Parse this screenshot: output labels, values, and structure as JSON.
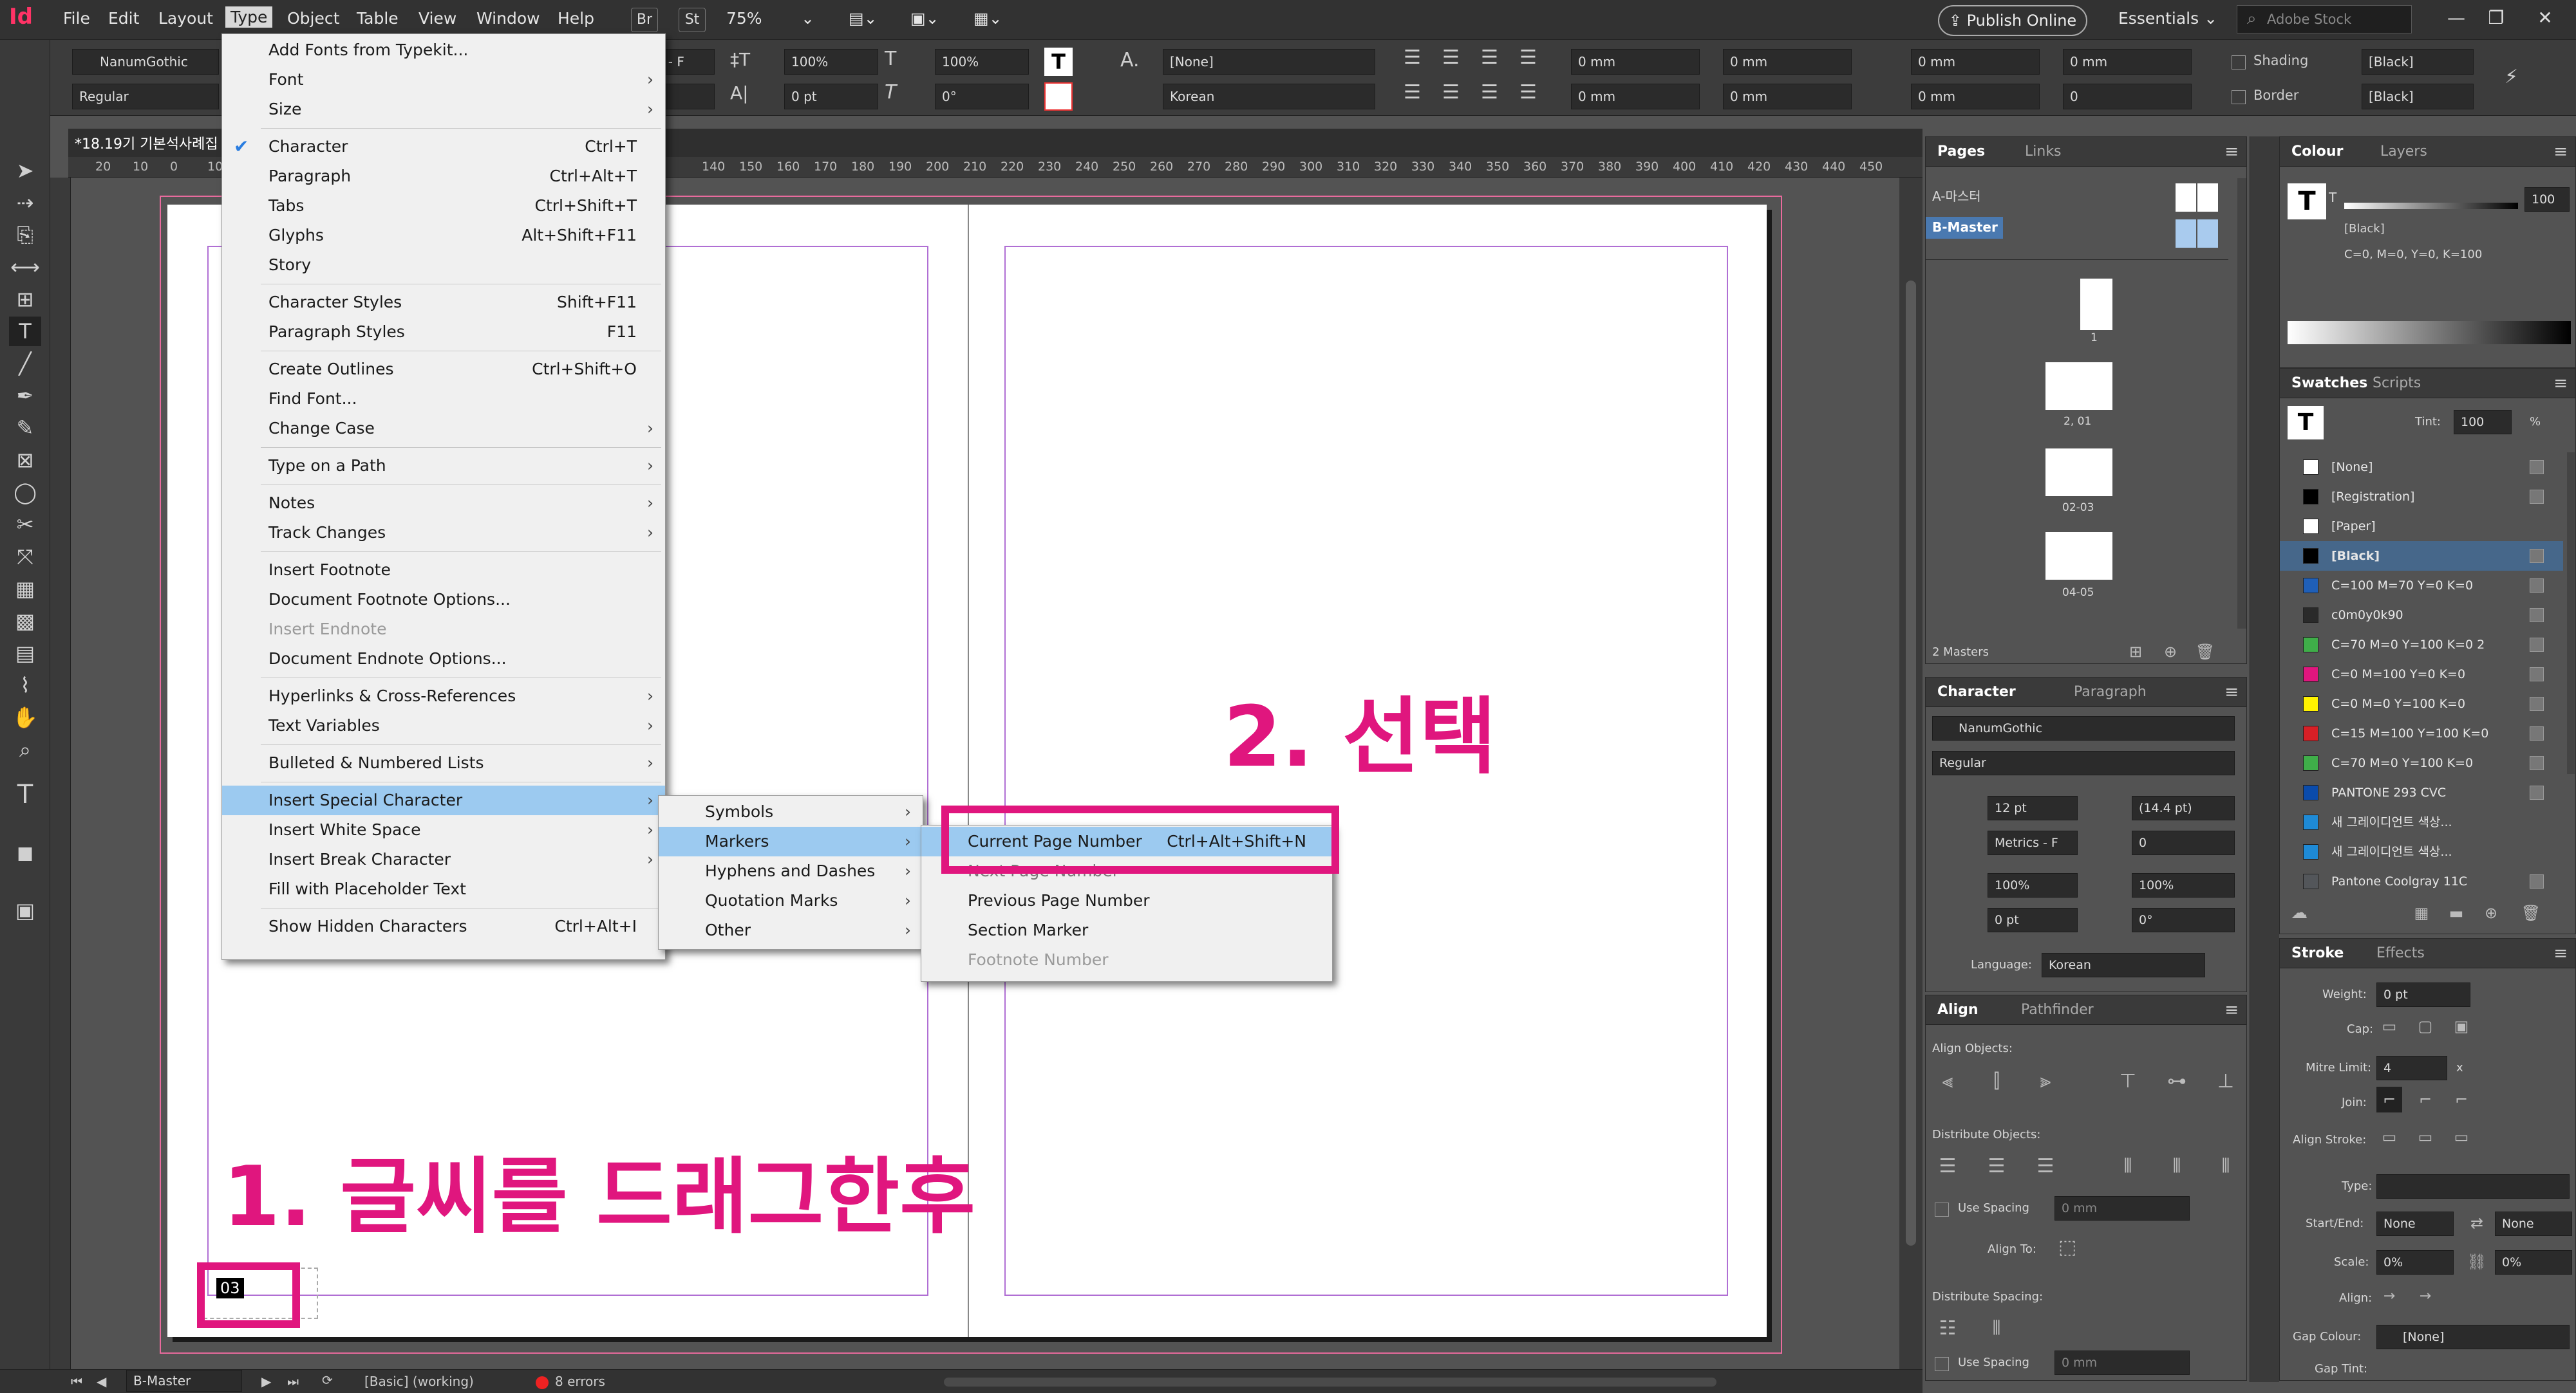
{
  "app": {
    "logo": "Id"
  },
  "menubar": {
    "items": [
      "File",
      "Edit",
      "Layout",
      "Type",
      "Object",
      "Table",
      "View",
      "Window",
      "Help"
    ],
    "br": "Br",
    "st": "St",
    "zoom": "75%",
    "publish": "Publish Online",
    "workspace": "Essentials",
    "stock_placeholder": "Adobe Stock"
  },
  "controlbar": {
    "font": "NanumGothic",
    "style": "Regular",
    "font_partial": "s - F",
    "leading_pct": "100%",
    "kerning_pt": "0 pt",
    "tracking_pct": "100%",
    "skew": "0°",
    "char_style": "[None]",
    "language": "Korean",
    "indent1": "0 mm",
    "indent2": "0 mm",
    "indent3": "0 mm",
    "indent4": "0 mm",
    "indent5": "0 mm",
    "indent6": "0 mm",
    "indent7": "0 mm",
    "indent8": "0",
    "shading": "Shading",
    "border": "Border",
    "black1": "[Black]",
    "black2": "[Black]"
  },
  "document": {
    "tab": "*18.19기 기본석사례집",
    "ruler_ticks": [
      "20",
      "10",
      "0",
      "10",
      "130",
      "140",
      "150",
      "160",
      "170",
      "180",
      "190",
      "200",
      "210",
      "220",
      "230",
      "240",
      "250",
      "260",
      "270",
      "280",
      "290",
      "300",
      "310",
      "320",
      "330",
      "340",
      "350",
      "360",
      "370",
      "380",
      "390",
      "400",
      "410",
      "420",
      "430",
      "440",
      "450"
    ],
    "page_number_text": "03"
  },
  "type_menu": {
    "items": [
      {
        "label": "Add Fonts from Typekit...",
        "shortcut": "",
        "arrow": false
      },
      {
        "label": "Font",
        "shortcut": "",
        "arrow": true
      },
      {
        "label": "Size",
        "shortcut": "",
        "arrow": true
      },
      {
        "label": "Character",
        "shortcut": "Ctrl+T",
        "arrow": false
      },
      {
        "label": "Paragraph",
        "shortcut": "Ctrl+Alt+T",
        "arrow": false
      },
      {
        "label": "Tabs",
        "shortcut": "Ctrl+Shift+T",
        "arrow": false
      },
      {
        "label": "Glyphs",
        "shortcut": "Alt+Shift+F11",
        "arrow": false
      },
      {
        "label": "Story",
        "shortcut": "",
        "arrow": false
      },
      {
        "label": "Character Styles",
        "shortcut": "Shift+F11",
        "arrow": false
      },
      {
        "label": "Paragraph Styles",
        "shortcut": "F11",
        "arrow": false
      },
      {
        "label": "Create Outlines",
        "shortcut": "Ctrl+Shift+O",
        "arrow": false
      },
      {
        "label": "Find Font...",
        "shortcut": "",
        "arrow": false
      },
      {
        "label": "Change Case",
        "shortcut": "",
        "arrow": true
      },
      {
        "label": "Type on a Path",
        "shortcut": "",
        "arrow": true
      },
      {
        "label": "Notes",
        "shortcut": "",
        "arrow": true
      },
      {
        "label": "Track Changes",
        "shortcut": "",
        "arrow": true
      },
      {
        "label": "Insert Footnote",
        "shortcut": "",
        "arrow": false
      },
      {
        "label": "Document Footnote Options...",
        "shortcut": "",
        "arrow": false
      },
      {
        "label": "Insert Endnote",
        "shortcut": "",
        "arrow": false
      },
      {
        "label": "Document Endnote Options...",
        "shortcut": "",
        "arrow": false
      },
      {
        "label": "Hyperlinks & Cross-References",
        "shortcut": "",
        "arrow": true
      },
      {
        "label": "Text Variables",
        "shortcut": "",
        "arrow": true
      },
      {
        "label": "Bulleted & Numbered Lists",
        "shortcut": "",
        "arrow": true
      },
      {
        "label": "Insert Special Character",
        "shortcut": "",
        "arrow": true
      },
      {
        "label": "Insert White Space",
        "shortcut": "",
        "arrow": true
      },
      {
        "label": "Insert Break Character",
        "shortcut": "",
        "arrow": true
      },
      {
        "label": "Fill with Placeholder Text",
        "shortcut": "",
        "arrow": false
      },
      {
        "label": "Show Hidden Characters",
        "shortcut": "Ctrl+Alt+I",
        "arrow": false
      }
    ]
  },
  "special_submenu": {
    "items": [
      "Symbols",
      "Markers",
      "Hyphens and Dashes",
      "Quotation Marks",
      "Other"
    ]
  },
  "markers_submenu": {
    "items": [
      {
        "label": "Current Page Number",
        "shortcut": "Ctrl+Alt+Shift+N"
      },
      {
        "label": "Next Page Number",
        "shortcut": ""
      },
      {
        "label": "Previous Page Number",
        "shortcut": ""
      },
      {
        "label": "Section Marker",
        "shortcut": ""
      },
      {
        "label": "Footnote Number",
        "shortcut": ""
      }
    ]
  },
  "annotations": {
    "step1": "1. 글씨를 드래그한후",
    "step2": "2. 선택"
  },
  "pages_panel": {
    "tabs": [
      "Pages",
      "Links"
    ],
    "masters": [
      "A-마스터",
      "B-Master"
    ],
    "page_labels": [
      "1",
      "2, 01",
      "02-03",
      "04-05"
    ],
    "footer": "2 Masters"
  },
  "character_panel": {
    "tabs": [
      "Character",
      "Paragraph"
    ],
    "font": "NanumGothic",
    "style": "Regular",
    "size": "12 pt",
    "leading": "(14.4 pt)",
    "kerning": "Metrics - F",
    "tracking": "0",
    "vscale": "100%",
    "hscale": "100%",
    "baseline": "0 pt",
    "skew": "0°",
    "language_label": "Language:",
    "language": "Korean"
  },
  "align_panel": {
    "tabs": [
      "Align",
      "Pathfinder"
    ],
    "align_objects": "Align Objects:",
    "distribute_objects": "Distribute Objects:",
    "use_spacing": "Use Spacing",
    "use_spacing_value": "0 mm",
    "align_to": "Align To:",
    "distribute_spacing": "Distribute Spacing:",
    "use_spacing2": "Use Spacing",
    "use_spacing_value2": "0 mm"
  },
  "colour_panel": {
    "tabs": [
      "Colour",
      "Layers"
    ],
    "tint": "100",
    "name": "[Black]",
    "cmyk": "C=0, M=0, Y=0, K=100"
  },
  "swatches_panel": {
    "tabs": [
      "Swatches",
      "Scripts"
    ],
    "tint_label": "Tint:",
    "tint": "100",
    "pct": "%",
    "items": [
      {
        "name": "[None]",
        "color": "#ffffff"
      },
      {
        "name": "[Registration]",
        "color": "#000000"
      },
      {
        "name": "[Paper]",
        "color": "#ffffff"
      },
      {
        "name": "[Black]",
        "color": "#000000"
      },
      {
        "name": "C=100 M=70 Y=0 K=0",
        "color": "#1f5fb8"
      },
      {
        "name": "c0m0y0k90",
        "color": "#2a2a2a"
      },
      {
        "name": "C=70 M=0 Y=100 K=0 2",
        "color": "#3fae49"
      },
      {
        "name": "C=0 M=100 Y=0 K=0",
        "color": "#e0167e"
      },
      {
        "name": "C=0 M=0 Y=100 K=0",
        "color": "#fff200"
      },
      {
        "name": "C=15 M=100 Y=100 K=0",
        "color": "#d71f26"
      },
      {
        "name": "C=70 M=0 Y=100 K=0",
        "color": "#3fae49"
      },
      {
        "name": "PANTONE 293 CVC",
        "color": "#0a4bab"
      },
      {
        "name": "새 그레이디언트 색상...",
        "color": "#1e8ad6"
      },
      {
        "name": "새 그레이디언트 색상...",
        "color": "#1e8ad6"
      },
      {
        "name": "Pantone Coolgray 11C",
        "color": "#53565a"
      }
    ]
  },
  "stroke_panel": {
    "tabs": [
      "Stroke",
      "Effects"
    ],
    "weight_label": "Weight:",
    "weight": "0 pt",
    "cap": "Cap:",
    "mitre_label": "Mitre Limit:",
    "mitre": "4",
    "times": "x",
    "join": "Join:",
    "align_stroke": "Align Stroke:",
    "type": "Type:",
    "start_end": "Start/End:",
    "start": "None",
    "end": "None",
    "scale": "Scale:",
    "scale1": "0%",
    "scale2": "0%",
    "align": "Align:",
    "gap_colour_label": "Gap Colour:",
    "gap_colour": "[None]",
    "gap_tint": "Gap Tint:"
  },
  "statusbar": {
    "page": "B-Master",
    "profile": "[Basic] (working)",
    "errors": "8 errors"
  }
}
